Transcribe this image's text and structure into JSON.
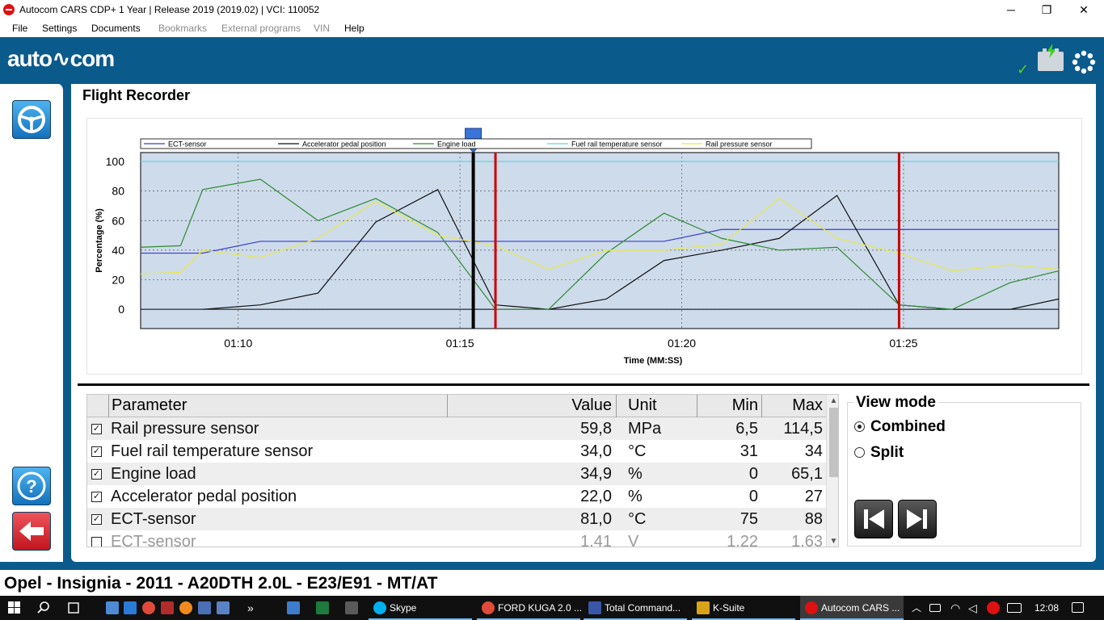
{
  "window": {
    "title": "Autocom CARS CDP+ 1 Year |  Release 2019 (2019.02)  |  VCI: 110052",
    "minimize": "─",
    "restore": "❐",
    "close": "✕"
  },
  "menu": {
    "file": "File",
    "settings": "Settings",
    "documents": "Documents",
    "bookmarks": "Bookmarks",
    "external": "External programs",
    "vin": "VIN",
    "help": "Help"
  },
  "header": {
    "logo": "auto∿com"
  },
  "page": {
    "title": "Flight Recorder"
  },
  "colors": {
    "brand": "#0b5a8c",
    "ect": "#3a3ad0",
    "accel": "#111111",
    "load": "#2e8b2e",
    "fuel_temp": "#5fd6e8",
    "rail": "#e8e84a",
    "marker": "#cc0000"
  },
  "icons": {
    "connection": "steering-wheel-icon",
    "help": "question-icon",
    "back": "arrow-left-icon",
    "battery": "battery-icon",
    "status": "checkmark-icon",
    "busy": "spinner-icon"
  },
  "chart_data": {
    "type": "line",
    "xlabel": "Time (MM:SS)",
    "ylabel": "Percentage (%)",
    "xlim": [
      67.8,
      88.5
    ],
    "ylim": [
      -13,
      106
    ],
    "x_ticks": [
      70,
      75,
      80,
      85
    ],
    "x_tick_labels": [
      "01:10",
      "01:15",
      "01:20",
      "01:25"
    ],
    "y_ticks": [
      0,
      20,
      40,
      60,
      80,
      100
    ],
    "grid": true,
    "background": "#cddbeb",
    "legend_position": "top",
    "cursor": 75.3,
    "markers": [
      75.8,
      84.9
    ],
    "series": [
      {
        "name": "ECT-sensor",
        "color": "#3a3ad0",
        "x": [
          67.8,
          69.2,
          70.5,
          71.8,
          73.1,
          74.5,
          75.8,
          77.0,
          78.3,
          79.6,
          80.9,
          82.2,
          83.5,
          84.9,
          86.1,
          87.4,
          88.5
        ],
        "y": [
          38,
          38,
          46,
          46,
          46,
          46,
          46,
          46,
          46,
          46,
          54,
          54,
          54,
          54,
          54,
          54,
          54
        ]
      },
      {
        "name": "Accelerator pedal position",
        "color": "#111111",
        "x": [
          69.2,
          70.5,
          71.8,
          73.1,
          74.5,
          75.8,
          77.0,
          78.3,
          79.6,
          80.9,
          82.2,
          83.5,
          84.9,
          86.1,
          87.4,
          88.5
        ],
        "y": [
          0,
          3,
          11,
          59,
          81,
          3,
          0,
          7,
          33,
          40,
          48,
          77,
          3,
          0,
          0,
          7
        ]
      },
      {
        "name": "Engine load",
        "color": "#2e8b2e",
        "x": [
          67.8,
          68.7,
          69.2,
          70.5,
          71.8,
          73.1,
          74.5,
          75.8,
          77.0,
          78.3,
          79.6,
          80.9,
          82.2,
          83.5,
          84.9,
          86.1,
          87.4,
          88.5
        ],
        "y": [
          42,
          43,
          81,
          88,
          60,
          75,
          52,
          0,
          0,
          38,
          65,
          48,
          40,
          42,
          3,
          0,
          18,
          26
        ]
      },
      {
        "name": "Fuel rail temperature sensor",
        "color": "#5fd6e8",
        "x": [
          67.8,
          88.5
        ],
        "y": [
          100,
          100
        ]
      },
      {
        "name": "Rail pressure sensor",
        "color": "#e8e84a",
        "x": [
          67.8,
          68.7,
          69.2,
          70.5,
          71.8,
          73.1,
          74.5,
          75.8,
          77.0,
          78.3,
          79.6,
          80.9,
          82.2,
          83.5,
          84.9,
          86.1,
          87.4,
          88.5
        ],
        "y": [
          24,
          25,
          40,
          35,
          48,
          73,
          50,
          43,
          27,
          40,
          40,
          44,
          75,
          48,
          38,
          26,
          30,
          27
        ]
      }
    ]
  },
  "table": {
    "headers": {
      "parameter": "Parameter",
      "value": "Value",
      "unit": "Unit",
      "min": "Min",
      "max": "Max"
    },
    "rows": [
      {
        "checked": "☑",
        "name": "Rail pressure sensor",
        "value": "59,8",
        "unit": "MPa",
        "min": "6,5",
        "max": "114,5"
      },
      {
        "checked": "☑",
        "name": "Fuel rail temperature sensor",
        "value": "34,0",
        "unit": "°C",
        "min": "31",
        "max": "34"
      },
      {
        "checked": "☑",
        "name": "Engine load",
        "value": "34,9",
        "unit": "%",
        "min": "0",
        "max": "65,1"
      },
      {
        "checked": "☑",
        "name": "Accelerator pedal position",
        "value": "22,0",
        "unit": "%",
        "min": "0",
        "max": "27"
      },
      {
        "checked": "☑",
        "name": "ECT-sensor",
        "value": "81,0",
        "unit": "°C",
        "min": "75",
        "max": "88"
      },
      {
        "checked": "☐",
        "name": "ECT-sensor",
        "value": "1,41",
        "unit": "V",
        "min": "1,22",
        "max": "1,63"
      }
    ]
  },
  "view_mode": {
    "title": "View mode",
    "combined": "Combined",
    "split": "Split",
    "selected": "Combined"
  },
  "vehicle": "Opel - Insignia - 2011 - A20DTH 2.0L - E23/E91 - MT/AT",
  "taskbar": {
    "skype": "Skype",
    "chrome": "FORD KUGA 2.0 ...",
    "totalcmd": "Total Command...",
    "ksuite": "K-Suite",
    "autocom": "Autocom CARS ...",
    "overflow": "»",
    "time": "12:08"
  }
}
